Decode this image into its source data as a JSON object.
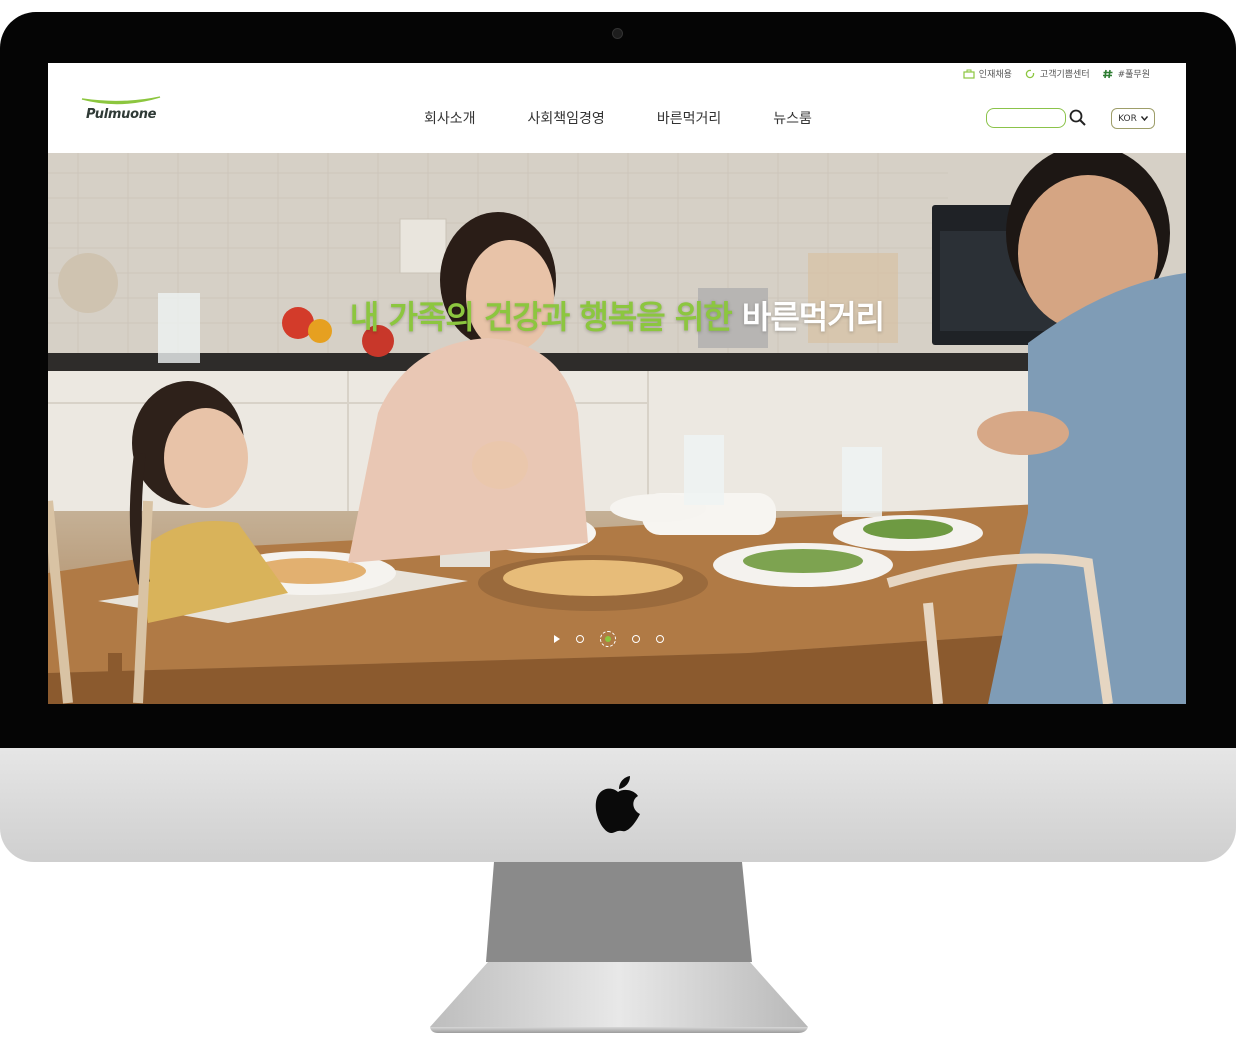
{
  "header": {
    "brand": "Pulmuone",
    "util": [
      {
        "label": "인재채용",
        "icon": "briefcase-icon"
      },
      {
        "label": "고객기쁨센터",
        "icon": "refresh-icon"
      },
      {
        "label": "#풀무원",
        "icon": "hash-icon"
      }
    ],
    "nav": [
      "회사소개",
      "사회책임경영",
      "바른먹거리",
      "뉴스룸"
    ],
    "search": {
      "value": "",
      "icon": "search-icon"
    },
    "language": "KOR"
  },
  "hero": {
    "title_green": "내 가족의 건강과 행복을 위한 ",
    "title_white": "바른먹거리",
    "slides": 4,
    "active_slide": 2
  },
  "colors": {
    "accent": "#8cc63f",
    "header_bg": "#ffffff",
    "bezel": "#050505"
  }
}
